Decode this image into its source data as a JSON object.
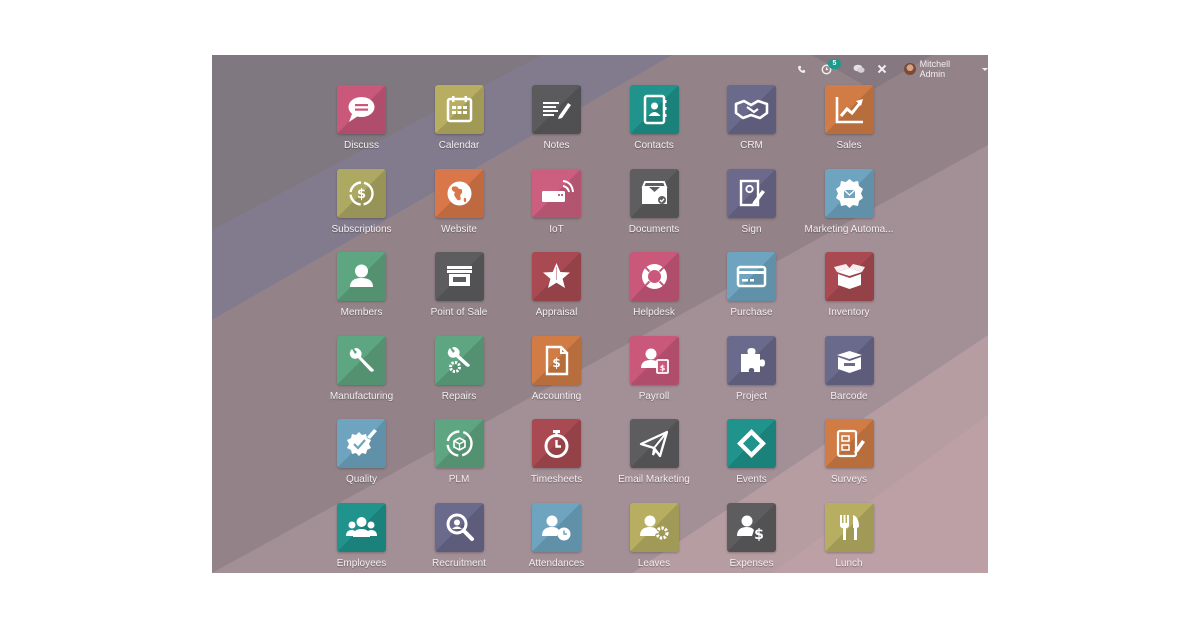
{
  "navbar": {
    "phone_icon": "phone-icon",
    "activity_icon": "activity-clock-icon",
    "activity_badge": "5",
    "messages_icon": "chat-icon",
    "debug_icon": "tools-icon",
    "user_name": "Mitchell Admin"
  },
  "colors": {
    "background": "#8f8087",
    "badge": "#1b9a8e",
    "text": "#f4f0f2"
  },
  "apps": [
    {
      "label": "Discuss",
      "icon": "chat-bubble-icon",
      "color": "#c9587b"
    },
    {
      "label": "Calendar",
      "icon": "calendar-icon",
      "color": "#b7ae62"
    },
    {
      "label": "Notes",
      "icon": "notes-pencil-icon",
      "color": "#5b5b5d"
    },
    {
      "label": "Contacts",
      "icon": "address-book-icon",
      "color": "#1f938c"
    },
    {
      "label": "CRM",
      "icon": "handshake-icon",
      "color": "#6a6a8c"
    },
    {
      "label": "Sales",
      "icon": "chart-up-icon",
      "color": "#d17c45"
    },
    {
      "label": "Subscriptions",
      "icon": "recurring-dollar-icon",
      "color": "#ada963"
    },
    {
      "label": "Website",
      "icon": "globe-icon",
      "color": "#d9774a"
    },
    {
      "label": "IoT",
      "icon": "iot-device-icon",
      "color": "#cc5f80"
    },
    {
      "label": "Documents",
      "icon": "inbox-tray-icon",
      "color": "#5e5e60"
    },
    {
      "label": "Sign",
      "icon": "sign-document-icon",
      "color": "#6c6a8c"
    },
    {
      "label": "Marketing Automa...",
      "icon": "gear-envelope-icon",
      "color": "#6ea4c0"
    },
    {
      "label": "Members",
      "icon": "user-icon",
      "color": "#5ea581"
    },
    {
      "label": "Point of Sale",
      "icon": "store-icon",
      "color": "#5d5d5f"
    },
    {
      "label": "Appraisal",
      "icon": "star-icon",
      "color": "#a94a52"
    },
    {
      "label": "Helpdesk",
      "icon": "lifebuoy-icon",
      "color": "#c9587b"
    },
    {
      "label": "Purchase",
      "icon": "credit-card-icon",
      "color": "#6ea4c0"
    },
    {
      "label": "Inventory",
      "icon": "box-open-icon",
      "color": "#a94a52"
    },
    {
      "label": "Manufacturing",
      "icon": "wrench-icon",
      "color": "#5ea581"
    },
    {
      "label": "Repairs",
      "icon": "wrench-gear-icon",
      "color": "#5ea581"
    },
    {
      "label": "Accounting",
      "icon": "invoice-dollar-icon",
      "color": "#d17c45"
    },
    {
      "label": "Payroll",
      "icon": "user-dollar-icon",
      "color": "#c9587b"
    },
    {
      "label": "Project",
      "icon": "puzzle-icon",
      "color": "#6a6a8c"
    },
    {
      "label": "Barcode",
      "icon": "box-barcode-icon",
      "color": "#6a6a8c"
    },
    {
      "label": "Quality",
      "icon": "quality-seal-icon",
      "color": "#6ea4c0"
    },
    {
      "label": "PLM",
      "icon": "cycle-box-icon",
      "color": "#5ea581"
    },
    {
      "label": "Timesheets",
      "icon": "stopwatch-icon",
      "color": "#a94a52"
    },
    {
      "label": "Email Marketing",
      "icon": "paper-plane-icon",
      "color": "#5d5d5f"
    },
    {
      "label": "Events",
      "icon": "ticket-icon",
      "color": "#1f938c"
    },
    {
      "label": "Surveys",
      "icon": "survey-clipboard-icon",
      "color": "#d17c45"
    },
    {
      "label": "Employees",
      "icon": "users-group-icon",
      "color": "#1f938c"
    },
    {
      "label": "Recruitment",
      "icon": "search-user-icon",
      "color": "#6a6a8c"
    },
    {
      "label": "Attendances",
      "icon": "user-clock-icon",
      "color": "#6ea4c0"
    },
    {
      "label": "Leaves",
      "icon": "user-gear-icon",
      "color": "#b7ae62"
    },
    {
      "label": "Expenses",
      "icon": "user-dollar-sign-icon",
      "color": "#5d5d5f"
    },
    {
      "label": "Lunch",
      "icon": "fork-knife-icon",
      "color": "#b7ae62"
    }
  ]
}
